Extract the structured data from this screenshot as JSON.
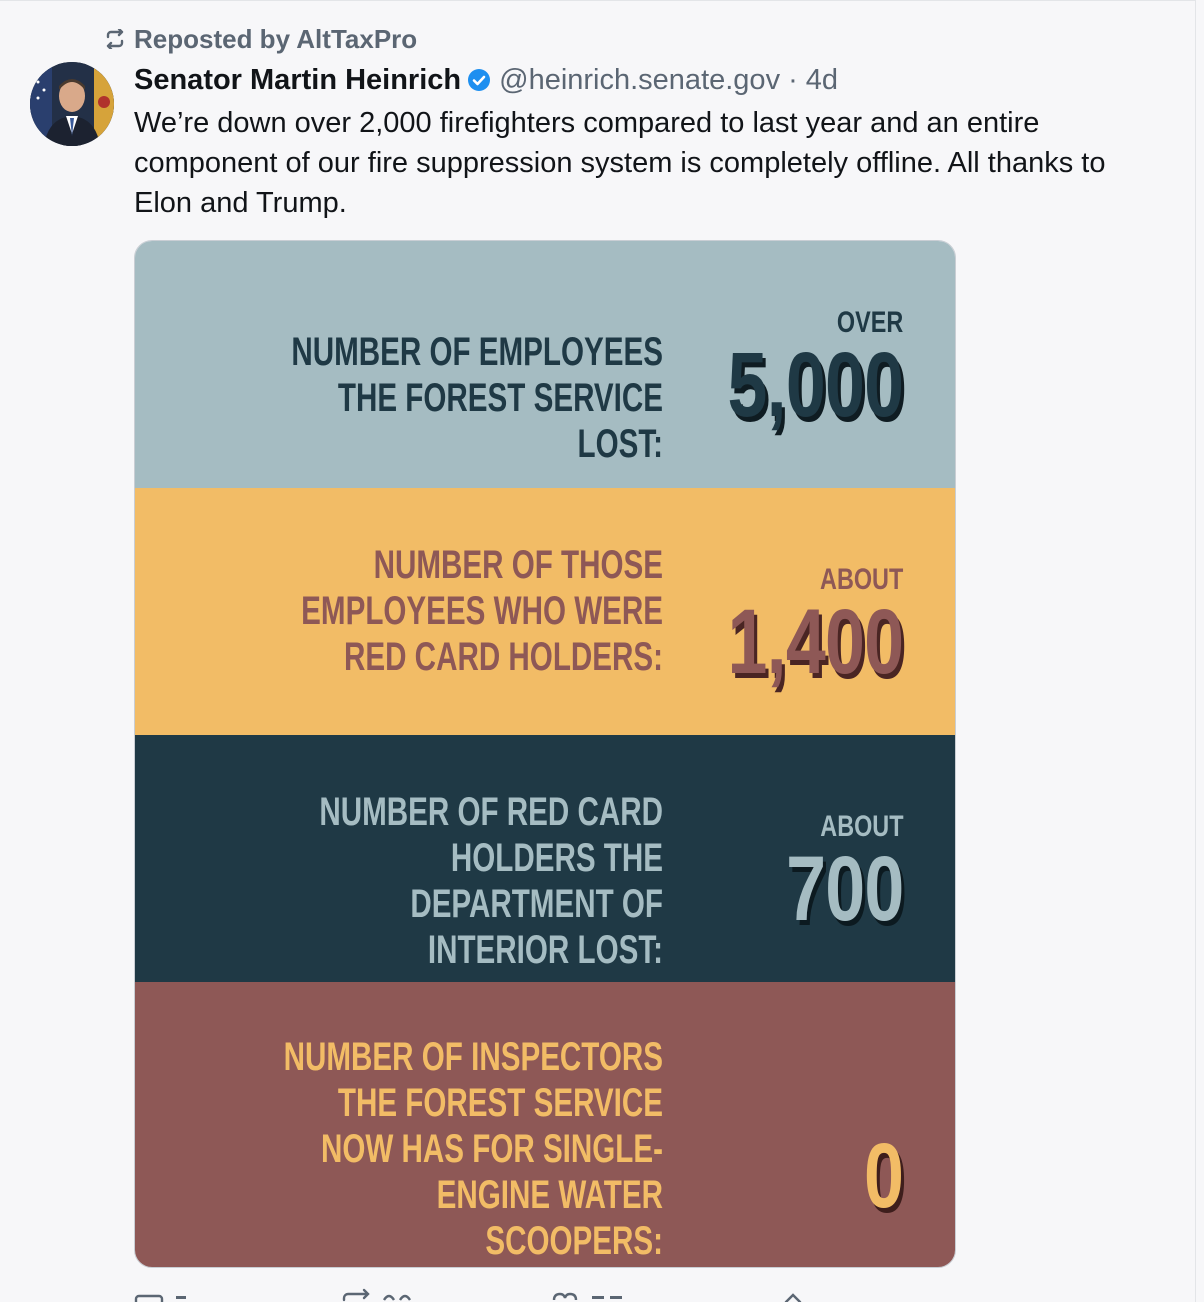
{
  "repost": {
    "icon": "repost-icon",
    "text": "Reposted by AltTaxPro"
  },
  "author": {
    "avatar_icon": "avatar",
    "display_name": "Senator Martin Heinrich",
    "verified_icon": "verified-badge-icon",
    "handle": "@heinrich.senate.gov",
    "separator": "·",
    "timestamp": "4d"
  },
  "post": {
    "text": "We’re down over 2,000 firefighters compared to last year and an entire component of our fire suppression system is completely offline. All thanks to Elon and Trump."
  },
  "infographic": {
    "rows": [
      {
        "label": "Number of employees the Forest Service lost:",
        "qualifier": "OVER",
        "value": "5,000"
      },
      {
        "label": "Number of those employees who were red card holders:",
        "qualifier": "ABOUT",
        "value": "1,400"
      },
      {
        "label": "Number of red card holders the Department of Interior lost:",
        "qualifier": "ABOUT",
        "value": "700"
      },
      {
        "label": "Number of inspectors the Forest Service now has for single-engine water scoopers:",
        "qualifier": "",
        "value": "0"
      }
    ],
    "colors": {
      "slate_blue": "#a5bcc2",
      "mustard": "#f2bc66",
      "dark_teal": "#1f3945",
      "brick": "#8e5856"
    }
  },
  "actions": {
    "reply_icon": "reply-icon",
    "repost_icon": "repost-icon",
    "like_icon": "heart-icon",
    "share_icon": "share-icon"
  },
  "colors": {
    "background": "#f7f7f9",
    "secondary_text": "#5b6673",
    "verified_blue": "#1d8ff0"
  }
}
